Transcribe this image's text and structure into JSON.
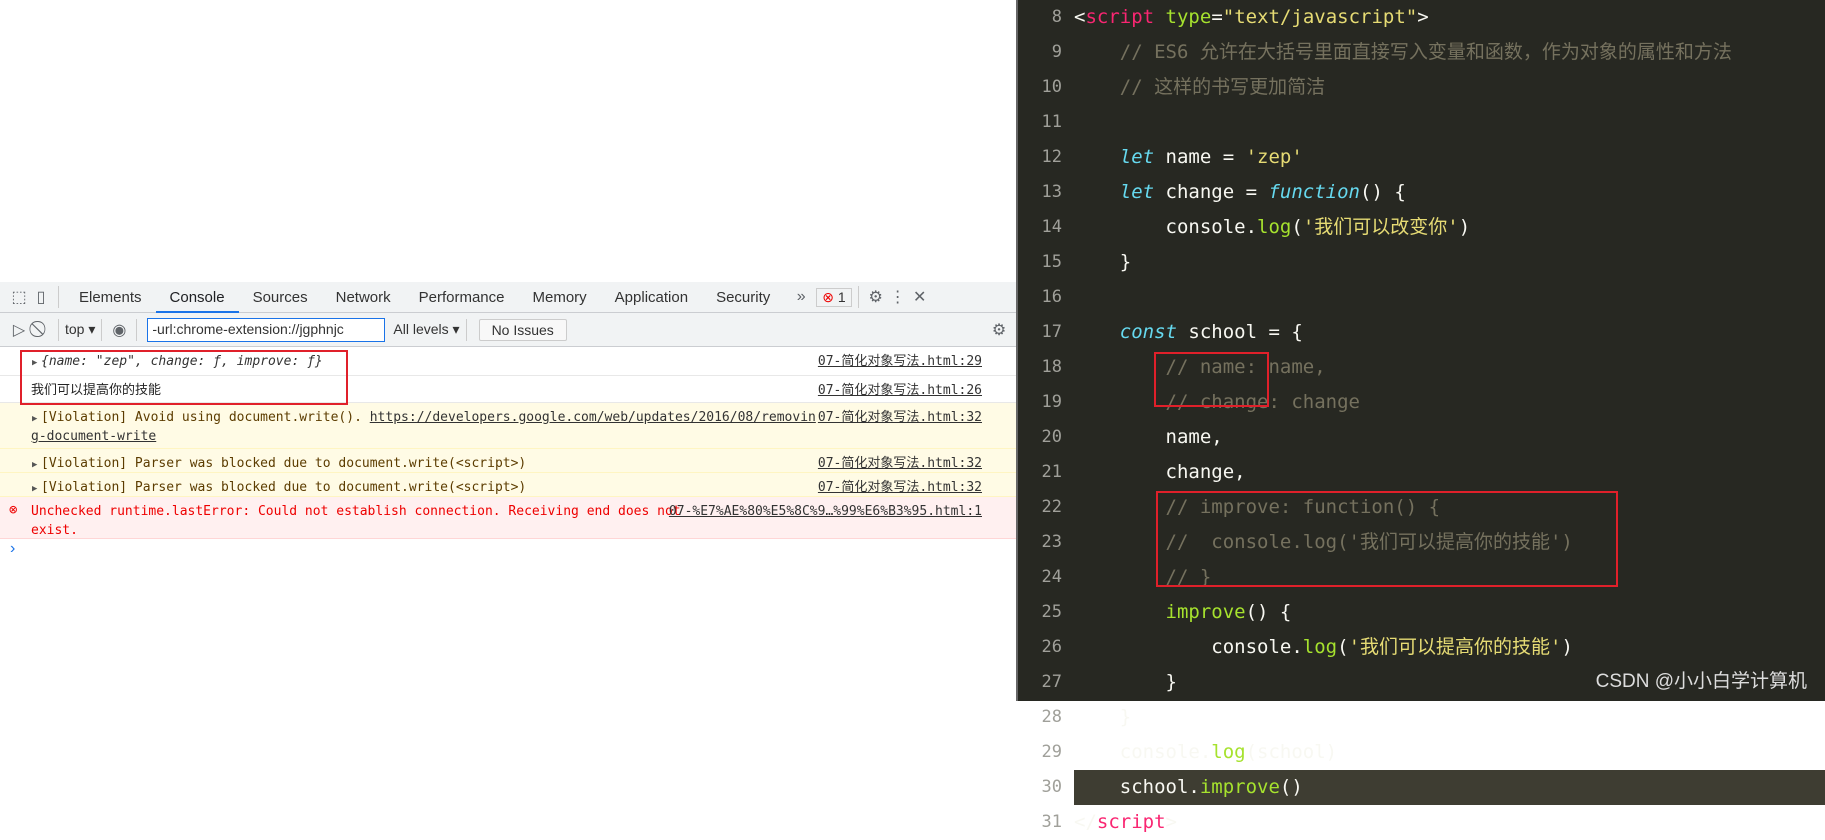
{
  "devtools": {
    "tabs": [
      "Elements",
      "Console",
      "Sources",
      "Network",
      "Performance",
      "Memory",
      "Application",
      "Security"
    ],
    "active_tab": "Console",
    "more_icon": "»",
    "error_count": "1",
    "toolbar": {
      "context": "top",
      "filter_value": "-url:chrome-extension://jgphnjc",
      "levels": "All levels",
      "issues": "No Issues"
    },
    "console": [
      {
        "type": "log",
        "text": "{name: \"zep\", change: ƒ, improve: ƒ}",
        "source": "07-简化对象写法.html:29"
      },
      {
        "type": "log",
        "text": "我们可以提高你的技能",
        "source": "07-简化对象写法.html:26"
      },
      {
        "type": "warn",
        "text": "[Violation] Avoid using document.write(). ",
        "link": "https://developers.google.com/web/updates/2016/08/removing-document-write",
        "source": "07-简化对象写法.html:32"
      },
      {
        "type": "warn",
        "text": "[Violation] Parser was blocked due to document.write(<script>)",
        "source": "07-简化对象写法.html:32"
      },
      {
        "type": "warn",
        "text": "[Violation] Parser was blocked due to document.write(<script>)",
        "source": "07-简化对象写法.html:32"
      },
      {
        "type": "error",
        "text": "Unchecked runtime.lastError: Could not establish connection. Receiving end does not exist.",
        "source": "07-%E7%AE%80%E5%8C%9…%99%E6%B3%95.html:1"
      }
    ],
    "prompt": "›"
  },
  "editor": {
    "lines": [
      {
        "n": "8",
        "t": [
          [
            "pl",
            "<"
          ],
          [
            "tag",
            "script"
          ],
          [
            "pl",
            " "
          ],
          [
            "attr",
            "type"
          ],
          [
            "pl",
            "="
          ],
          [
            "str",
            "\"text/javascript\""
          ],
          [
            "pl",
            ">"
          ]
        ]
      },
      {
        "n": "9",
        "t": [
          [
            "cm",
            "    // ES6 允许在大括号里面直接写入变量和函数，作为对象的属性和方法"
          ]
        ]
      },
      {
        "n": "10",
        "t": [
          [
            "cm",
            "    // 这样的书写更加简洁"
          ]
        ]
      },
      {
        "n": "11",
        "t": []
      },
      {
        "n": "12",
        "t": [
          [
            "pl",
            "    "
          ],
          [
            "kw",
            "let"
          ],
          [
            "pl",
            " name = "
          ],
          [
            "str",
            "'zep'"
          ]
        ]
      },
      {
        "n": "13",
        "t": [
          [
            "pl",
            "    "
          ],
          [
            "kw",
            "let"
          ],
          [
            "pl",
            " change = "
          ],
          [
            "kw",
            "function"
          ],
          [
            "pl",
            "() {"
          ]
        ]
      },
      {
        "n": "14",
        "t": [
          [
            "pl",
            "        console."
          ],
          [
            "fn",
            "log"
          ],
          [
            "pl",
            "("
          ],
          [
            "str",
            "'我们可以改变你'"
          ],
          [
            "pl",
            ")"
          ]
        ]
      },
      {
        "n": "15",
        "t": [
          [
            "pl",
            "    }"
          ]
        ]
      },
      {
        "n": "16",
        "t": []
      },
      {
        "n": "17",
        "t": [
          [
            "pl",
            "    "
          ],
          [
            "kw",
            "const"
          ],
          [
            "pl",
            " school = {"
          ]
        ]
      },
      {
        "n": "18",
        "t": [
          [
            "cm",
            "        // name: name,"
          ]
        ]
      },
      {
        "n": "19",
        "t": [
          [
            "cm",
            "        // change: change"
          ]
        ]
      },
      {
        "n": "20",
        "t": [
          [
            "pl",
            "        name,"
          ]
        ]
      },
      {
        "n": "21",
        "t": [
          [
            "pl",
            "        change,"
          ]
        ]
      },
      {
        "n": "22",
        "t": [
          [
            "cm",
            "        // improve: function() {"
          ]
        ]
      },
      {
        "n": "23",
        "t": [
          [
            "cm",
            "        //  console.log('我们可以提高你的技能')"
          ]
        ]
      },
      {
        "n": "24",
        "t": [
          [
            "cm",
            "        // }"
          ]
        ]
      },
      {
        "n": "25",
        "t": [
          [
            "pl",
            "        "
          ],
          [
            "fn",
            "improve"
          ],
          [
            "pl",
            "() {"
          ]
        ]
      },
      {
        "n": "26",
        "t": [
          [
            "pl",
            "            console."
          ],
          [
            "fn",
            "log"
          ],
          [
            "pl",
            "("
          ],
          [
            "str",
            "'我们可以提高你的技能'"
          ],
          [
            "pl",
            ")"
          ]
        ]
      },
      {
        "n": "27",
        "t": [
          [
            "pl",
            "        }"
          ]
        ]
      },
      {
        "n": "28",
        "t": [
          [
            "pl",
            "    }"
          ]
        ]
      },
      {
        "n": "29",
        "t": [
          [
            "pl",
            "    console."
          ],
          [
            "fn",
            "log"
          ],
          [
            "pl",
            "(school)"
          ]
        ]
      },
      {
        "n": "30",
        "t": [
          [
            "pl",
            "    school."
          ],
          [
            "fn",
            "improve"
          ],
          [
            "pl",
            "()"
          ]
        ]
      },
      {
        "n": "31",
        "t": [
          [
            "pl",
            "</"
          ],
          [
            "tag",
            "script"
          ],
          [
            "pl",
            ">"
          ]
        ]
      }
    ],
    "current_line": "30"
  },
  "watermark": "CSDN @小小白学计算机",
  "colors": {
    "highlight_box": "#e0202a",
    "editor_bg": "#272822",
    "accent": "#1a73e8"
  }
}
